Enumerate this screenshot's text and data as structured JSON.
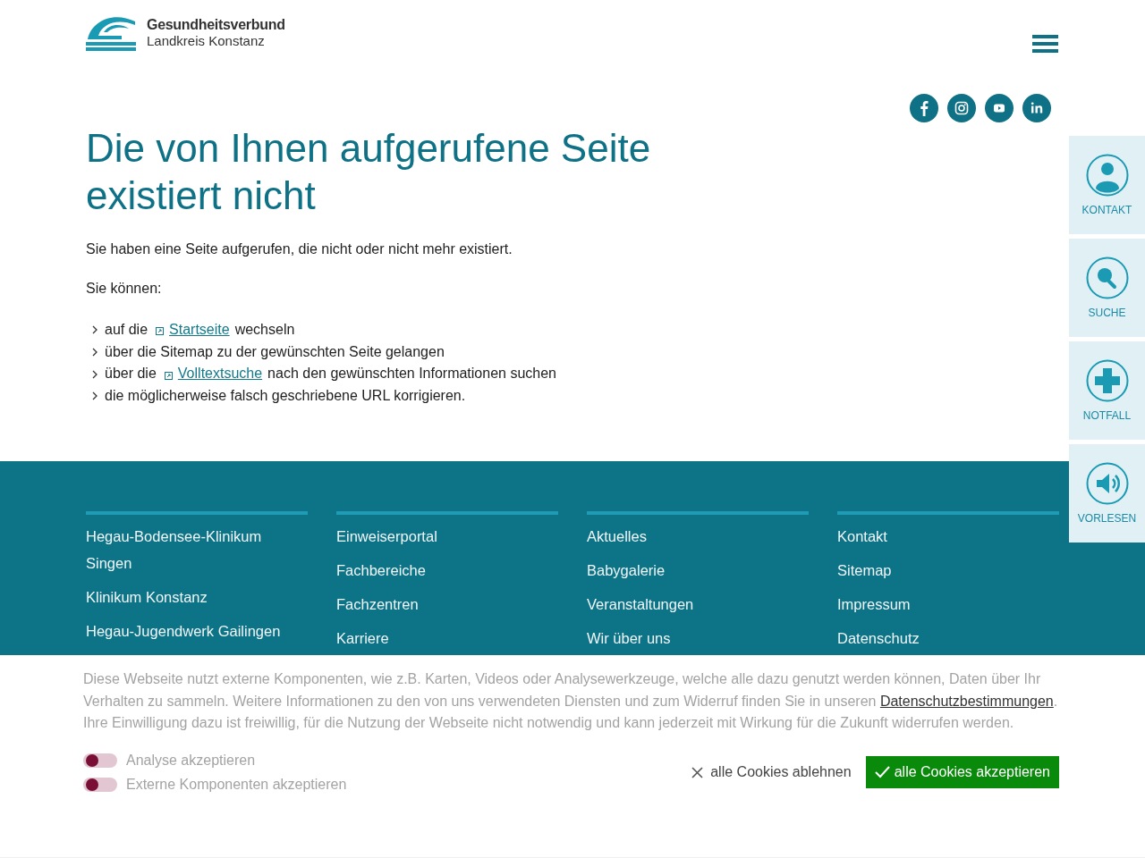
{
  "logo": {
    "line_1": "Gesundheitsverbund",
    "line_2": "Landkreis Konstanz"
  },
  "social": [
    {
      "kind": "facebook"
    },
    {
      "kind": "instagram"
    },
    {
      "kind": "youtube"
    },
    {
      "kind": "linkedin"
    }
  ],
  "side_tabs": [
    {
      "kind": "contact",
      "label": "KONTAKT"
    },
    {
      "kind": "search",
      "label": "SUCHE"
    },
    {
      "kind": "emergency",
      "label": "NOTFALL"
    },
    {
      "kind": "speaker",
      "label": "VORLESEN"
    }
  ],
  "heading": "Die von Ihnen aufgerufene Seite existiert nicht",
  "intro": "Sie haben eine Seite aufgerufen, die nicht oder nicht mehr existiert.",
  "options_label": "Sie können:",
  "options": [
    [
      {
        "kind": "text",
        "text": "auf die"
      },
      {
        "kind": "link",
        "text": "Startseite"
      },
      {
        "kind": "text",
        "text": "wechseln"
      }
    ],
    [
      {
        "kind": "text",
        "text": "über die Sitemap zu der gewünschten Seite gelangen"
      }
    ],
    [
      {
        "kind": "text",
        "text": "über die"
      },
      {
        "kind": "link",
        "text": "Volltextsuche"
      },
      {
        "kind": "text",
        "text": "nach den gewünschten Informationen suchen"
      }
    ],
    [
      {
        "kind": "text",
        "text": "die möglicherweise falsch geschriebene URL korrigieren."
      }
    ]
  ],
  "footer_columns": [
    [
      "Hegau-Bodensee-Klinikum Singen",
      "Klinikum Konstanz",
      "Hegau-Jugendwerk Gailingen"
    ],
    [
      "Einweiserportal",
      "Fachbereiche",
      "Fachzentren",
      "Karriere"
    ],
    [
      "Aktuelles",
      "Babygalerie",
      "Veranstaltungen",
      "Wir über uns"
    ],
    [
      "Kontakt",
      "Sitemap",
      "Impressum",
      "Datenschutz"
    ]
  ],
  "cookie": {
    "text_1": "Diese Webseite nutzt externe Komponenten, wie z.B. Karten, Videos oder Analysewerkzeuge, welche alle dazu genutzt werden können, Daten über Ihr Verhalten zu sammeln. Weitere Informationen zu den von uns verwendeten Diensten und zum Widerruf finden Sie in unseren",
    "link": "Datenschutzbestimmungen",
    "link_end": ".",
    "text_2": "Ihre Einwilligung dazu ist freiwillig, für die Nutzung der Webseite nicht notwendig und kann jederzeit mit Wirkung für die Zukunft widerrufen werden.",
    "toggles": [
      {
        "label": "Analyse akzeptieren",
        "on": false
      },
      {
        "label": "Externe Komponenten akzeptieren",
        "on": false
      }
    ],
    "decline": "alle Cookies ablehnen",
    "accept": "alle Cookies akzeptieren"
  }
}
